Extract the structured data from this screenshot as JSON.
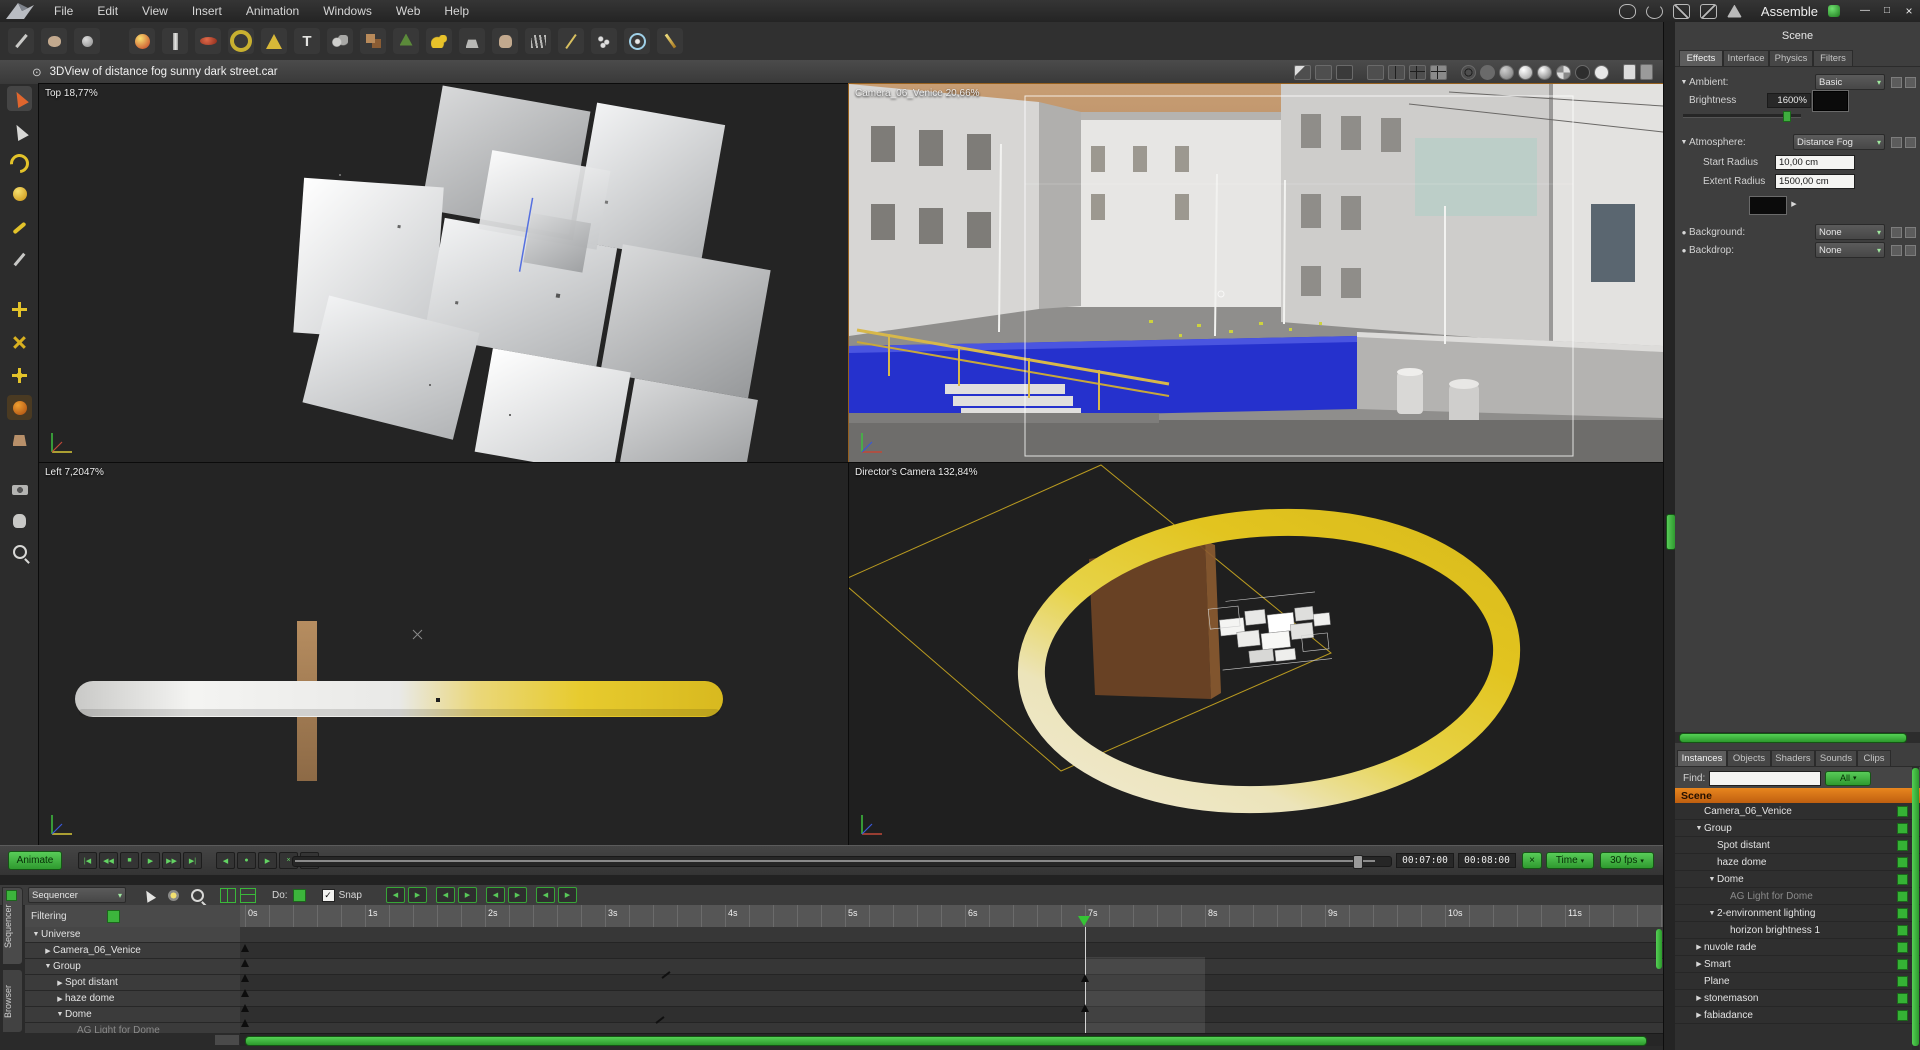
{
  "window": {
    "mode": "Assemble",
    "title": "3DView of distance fog sunny dark street.car"
  },
  "menu": {
    "items": [
      "File",
      "Edit",
      "View",
      "Insert",
      "Animation",
      "Windows",
      "Web",
      "Help"
    ]
  },
  "icons": {
    "viewport_menu": "⊙",
    "dd_arrow": "▾",
    "min": "—",
    "max": "□",
    "close": "×",
    "first": "|◀",
    "prev": "◀◀",
    "stop": "■",
    "play": "▶",
    "next": "▶▶",
    "last": "▶|",
    "range_start": "◀",
    "record": "●",
    "range_end": "▶",
    "trash": "×",
    "cycle": "▽",
    "kf_prev": "◀",
    "kf_next": "▶",
    "check": "✓",
    "bullet": "●",
    "text_tool": "T",
    "x_toggle": "×"
  },
  "viewports": {
    "top_left": "Top 18,77%",
    "top_right": "Camera_06_Venice 20,66%",
    "bottom_left": "Left 7,2047%",
    "bottom_right": "Director's Camera 132,84%"
  },
  "properties": {
    "title": "Scene",
    "tabs": [
      "Effects",
      "Interface",
      "Physics",
      "Filters"
    ],
    "ambient": {
      "label": "Ambient:",
      "value": "Basic",
      "brightness_label": "Brightness",
      "brightness_value": "1600%"
    },
    "atmosphere": {
      "label": "Atmosphere:",
      "value": "Distance Fog",
      "start_label": "Start Radius",
      "start_value": "10,00 cm",
      "extent_label": "Extent Radius",
      "extent_value": "1500,00 cm"
    },
    "background": {
      "label": "Background:",
      "value": "None"
    },
    "backdrop": {
      "label": "Backdrop:",
      "value": "None"
    }
  },
  "browser": {
    "tabs": [
      "Instances",
      "Objects",
      "Shaders",
      "Sounds",
      "Clips"
    ],
    "find_label": "Find:",
    "filter_all": "All",
    "root": "Scene",
    "items": [
      {
        "label": "Camera_06_Venice",
        "depth": 1,
        "tri": ""
      },
      {
        "label": "Group",
        "depth": 1,
        "tri": "▼"
      },
      {
        "label": "Spot distant",
        "depth": 2,
        "tri": ""
      },
      {
        "label": "haze dome",
        "depth": 2,
        "tri": ""
      },
      {
        "label": "Dome",
        "depth": 2,
        "tri": "▼"
      },
      {
        "label": "AG Light for Dome",
        "depth": 3,
        "tri": "",
        "dim": true
      },
      {
        "label": "2-environment lighting",
        "depth": 2,
        "tri": "▼"
      },
      {
        "label": "horizon brightness 1",
        "depth": 3,
        "tri": ""
      },
      {
        "label": "nuvole rade",
        "depth": 1,
        "tri": "▶"
      },
      {
        "label": "Smart",
        "depth": 1,
        "tri": "▶"
      },
      {
        "label": "Plane",
        "depth": 1,
        "tri": ""
      },
      {
        "label": "stonemason",
        "depth": 1,
        "tri": "▶"
      },
      {
        "label": "fabiadance",
        "depth": 1,
        "tri": "▶"
      }
    ]
  },
  "timeline": {
    "animate": "Animate",
    "mode": "Sequencer",
    "do_label": "Do:",
    "snap": "Snap",
    "filtering": "Filtering",
    "current_time": "00:07:00",
    "end_time": "00:08:00",
    "time_mode": "Time",
    "fps": "30 fps",
    "side_tabs": [
      "Sequencer",
      "Browser"
    ],
    "ruler": [
      "0s",
      "1s",
      "2s",
      "3s",
      "4s",
      "5s",
      "6s",
      "7s",
      "8s",
      "9s",
      "10s",
      "11s"
    ],
    "tracks": [
      {
        "label": "Universe",
        "depth": 0,
        "tri": "▼"
      },
      {
        "label": "Camera_06_Venice",
        "depth": 1,
        "tri": "▶"
      },
      {
        "label": "Group",
        "depth": 1,
        "tri": "▼"
      },
      {
        "label": "Spot distant",
        "depth": 2,
        "tri": "▶"
      },
      {
        "label": "haze dome",
        "depth": 2,
        "tri": "▶"
      },
      {
        "label": "Dome",
        "depth": 2,
        "tri": "▼"
      },
      {
        "label": "AG Light for Dome",
        "depth": 3,
        "tri": ""
      }
    ],
    "keyframes": [
      {
        "track": 1,
        "t": 0
      },
      {
        "track": 2,
        "t": 0
      },
      {
        "track": 3,
        "t": 0
      },
      {
        "track": 4,
        "t": 0
      },
      {
        "track": 5,
        "t": 0
      },
      {
        "track": 6,
        "t": 0
      },
      {
        "track": 3,
        "t": 7
      },
      {
        "track": 5,
        "t": 7
      },
      {
        "track": 3,
        "t": 3.5,
        "type": "slash"
      },
      {
        "track": 6,
        "t": 3.45,
        "type": "slash"
      }
    ]
  }
}
